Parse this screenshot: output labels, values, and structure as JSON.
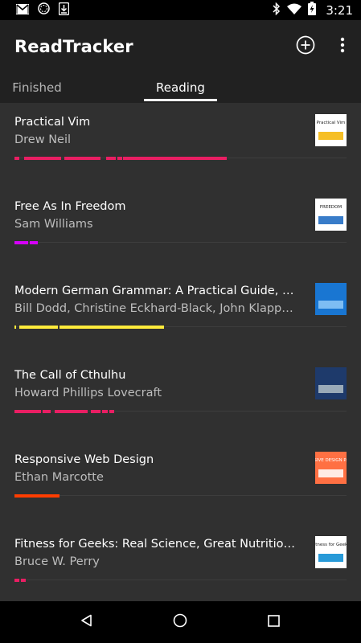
{
  "status_bar": {
    "time": "3:21",
    "icons": [
      "gmail-icon",
      "sync-icon",
      "download-icon",
      "bluetooth-icon",
      "wifi-icon",
      "battery-charging-icon"
    ]
  },
  "app_bar": {
    "title": "ReadTracker",
    "actions": [
      "add-circle-icon",
      "more-vert-icon"
    ]
  },
  "tabs": [
    {
      "label": "Finished",
      "selected": false
    },
    {
      "label": "Reading",
      "selected": true
    }
  ],
  "books": [
    {
      "title": "Practical Vim",
      "author": "Drew Neil",
      "color": "#e91e63",
      "cover": {
        "bg": "#ffffff",
        "text": "Practical Vim",
        "accent": "#f4b400"
      },
      "segments": [
        [
          0,
          1.5
        ],
        [
          3,
          14
        ],
        [
          15,
          26
        ],
        [
          27.5,
          30.5
        ],
        [
          31,
          32.5
        ],
        [
          32.8,
          64
        ]
      ]
    },
    {
      "title": "Free As In Freedom",
      "author": "Sam Williams",
      "color": "#d500f9",
      "cover": {
        "bg": "#ffffff",
        "text": "FREEDOM",
        "accent": "#1565c0"
      },
      "segments": [
        [
          0,
          4
        ],
        [
          4.5,
          7
        ]
      ]
    },
    {
      "title": "Modern German Grammar: A Practical Guide, Second Edition",
      "author": "Bill Dodd, Christine Eckhard-Black, John Klapper and Ruth Whittle",
      "color": "#ffeb3b",
      "cover": {
        "bg": "#1976d2",
        "text": "",
        "accent": "#90caf9"
      },
      "segments": [
        [
          0,
          0.5
        ],
        [
          1.5,
          13
        ],
        [
          13.5,
          45
        ]
      ]
    },
    {
      "title": "The Call of Cthulhu",
      "author": "Howard Phillips Lovecraft",
      "color": "#e91e63",
      "cover": {
        "bg": "#1e3a6b",
        "text": "",
        "accent": "#b0bec5"
      },
      "segments": [
        [
          0,
          8
        ],
        [
          8.5,
          11
        ],
        [
          12,
          22
        ],
        [
          23,
          26
        ],
        [
          26.5,
          28
        ],
        [
          28.5,
          30
        ]
      ]
    },
    {
      "title": "Responsive Web Design",
      "author": "Ethan Marcotte",
      "color": "#ff3d00",
      "cover": {
        "bg": "#ff7043",
        "text": "RESPONSIVE DESIGN PATTERNS",
        "accent": "#ffffff"
      },
      "segments": [
        [
          0,
          13.5
        ]
      ]
    },
    {
      "title": "Fitness for Geeks: Real Science, Great Nutrition, and Good Health",
      "author": "Bruce W. Perry",
      "color": "#e91e63",
      "cover": {
        "bg": "#ffffff",
        "text": "Fitness for Geeks",
        "accent": "#0288d1"
      },
      "segments": [
        [
          0,
          1.5
        ],
        [
          2,
          3.5
        ]
      ]
    }
  ],
  "nav_bar": {
    "buttons": [
      "back-icon",
      "home-icon",
      "recents-icon"
    ]
  }
}
